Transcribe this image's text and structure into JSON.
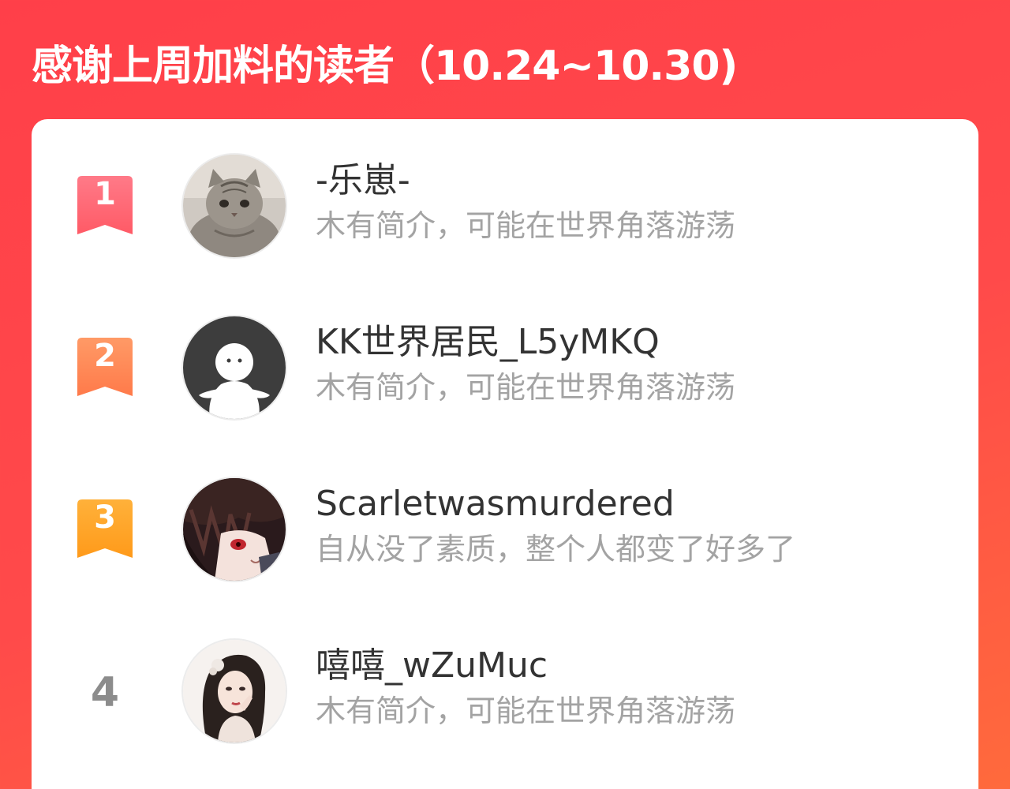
{
  "header": {
    "title": "感谢上周加料的读者（10.24~10.30)"
  },
  "readers": [
    {
      "rank": "1",
      "name": "-乐崽-",
      "bio": "木有简介，可能在世界角落游荡",
      "badge_color_top": "#ff7a88",
      "badge_color_bottom": "#ff5a66",
      "avatar": "cat-photo"
    },
    {
      "rank": "2",
      "name": "KK世界居民_L5yMKQ",
      "bio": "木有简介，可能在世界角落游荡",
      "badge_color_top": "#ff9a66",
      "badge_color_bottom": "#ff7a4a",
      "avatar": "default-ghost-avatar"
    },
    {
      "rank": "3",
      "name": "Scarletwasmurdered",
      "bio": "自从没了素质，整个人都变了好多了",
      "badge_color_top": "#ffb13a",
      "badge_color_bottom": "#ff9a1a",
      "avatar": "anime-character-portrait"
    },
    {
      "rank": "4",
      "name": "嘻嘻_wZuMuc",
      "bio": "木有简介，可能在世界角落游荡",
      "avatar": "illustrated-girl-portrait"
    }
  ]
}
